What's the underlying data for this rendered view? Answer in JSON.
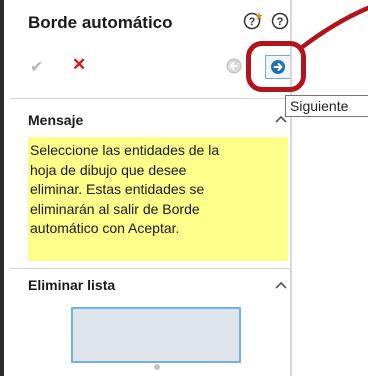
{
  "panel": {
    "title": "Borde automático",
    "help_icons": [
      "what-is-new-help-icon",
      "help-icon"
    ],
    "actions": {
      "ok": "check-icon",
      "cancel": "close-icon",
      "back": "back-arrow-icon",
      "next": "next-arrow-icon"
    },
    "tooltip": "Siguiente",
    "sections": {
      "message": {
        "header": "Mensaje",
        "lines": [
          "Seleccione las entidades de la",
          "hoja de dibujo que desee",
          "eliminar. Estas entidades se",
          "eliminarán al salir de Borde",
          "automático con Aceptar."
        ]
      },
      "delete_list": {
        "header": "Eliminar lista"
      }
    }
  },
  "colors": {
    "annotation_red": "#b0151c",
    "message_bg": "#fdfd8a",
    "list_border": "#6fb0e6",
    "list_bg": "#dfe4ea",
    "cancel_red": "#d21a1a",
    "next_arrow_blue": "#1d6fb8"
  }
}
